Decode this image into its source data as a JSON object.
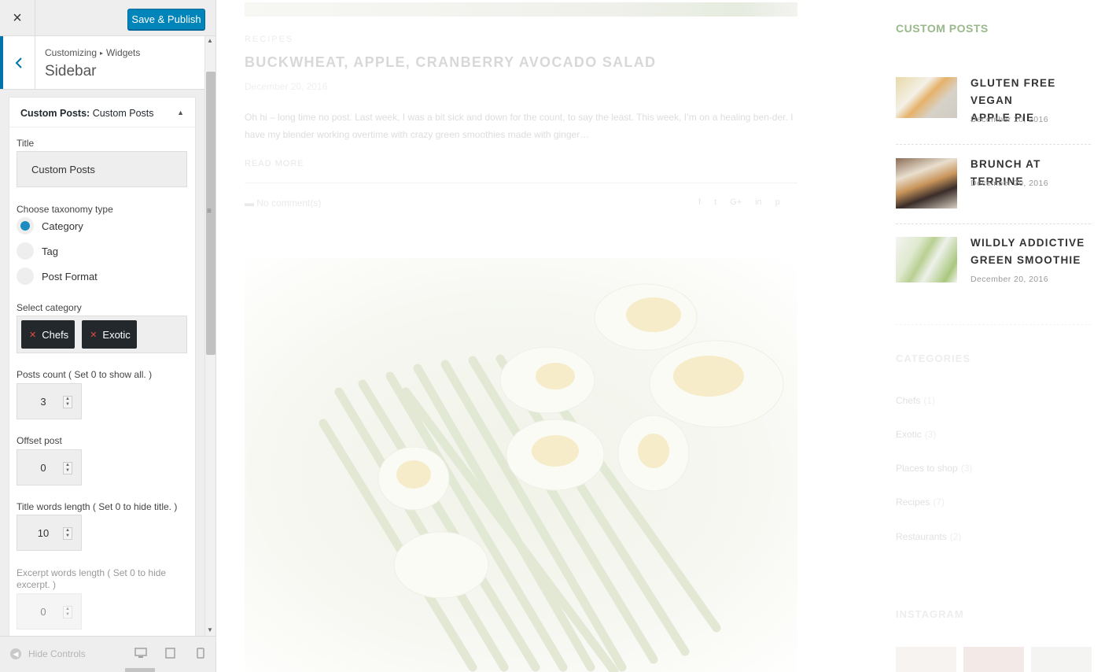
{
  "customizer": {
    "close_icon": "×",
    "save_label": "Save & Publish",
    "breadcrumb_root": "Customizing",
    "breadcrumb_child": "Widgets",
    "section_title": "Sidebar",
    "widget": {
      "header_bold": "Custom Posts:",
      "header_name": "Custom Posts",
      "title_label": "Title",
      "title_value": "Custom Posts",
      "taxonomy_label": "Choose taxonomy type",
      "taxonomy_options": [
        "Category",
        "Tag",
        "Post Format"
      ],
      "taxonomy_selected": "Category",
      "category_label": "Select category",
      "categories_selected": [
        "Chefs",
        "Exotic"
      ],
      "posts_count_label": "Posts count ( Set 0 to show all. )",
      "posts_count": "3",
      "offset_label": "Offset post",
      "offset": "0",
      "title_words_label": "Title words length ( Set 0 to hide title. )",
      "title_words": "10",
      "excerpt_words_label_1": "Excerpt words length ( Set 0 to hide",
      "excerpt_words_label_2": "excerpt. )",
      "excerpt_words": "0"
    },
    "hide_controls": "Hide Controls"
  },
  "preview": {
    "post": {
      "category": "RECIPES",
      "title": "BUCKWHEAT, APPLE, CRANBERRY AVOCADO SALAD",
      "date": "December 20, 2016",
      "excerpt": "Oh hi – long time no post. Last week, I was a bit sick and down for the count, to say the least. This week, I’m on a healing ben-der. I have my blender working overtime with crazy green smoothies made with ginger…",
      "read_more": "READ MORE",
      "comments": "No comment(s)",
      "share_icons": [
        "f",
        "t",
        "G+",
        "in",
        "p"
      ]
    },
    "sidebar": {
      "custom_posts_title": "CUSTOM POSTS",
      "custom_posts": [
        {
          "title_1": "GLUTEN FREE VEGAN",
          "title_2": "APPLE PIE",
          "date": "December 20, 2016"
        },
        {
          "title_1": "BRUNCH AT TERRINE",
          "title_2": "",
          "date": "December 20, 2016"
        },
        {
          "title_1": "WILDLY ADDICTIVE",
          "title_2": "GREEN SMOOTHIE",
          "date": "December 20, 2016"
        }
      ],
      "categories_title": "CATEGORIES",
      "categories": [
        {
          "name": "Chefs",
          "count": "(1)"
        },
        {
          "name": "Exotic",
          "count": "(3)"
        },
        {
          "name": "Places to shop",
          "count": "(3)"
        },
        {
          "name": "Recipes",
          "count": "(7)"
        },
        {
          "name": "Restaurants",
          "count": "(2)"
        }
      ],
      "instagram_title": "INSTAGRAM"
    }
  },
  "colors": {
    "accent_blue": "#0085ba",
    "sidebar_title_green": "#98b98a"
  }
}
